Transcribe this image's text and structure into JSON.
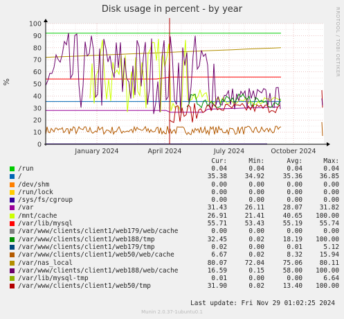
{
  "title": "Disk usage in percent - by year",
  "side_text": "RRDTOOL / TOBI OETIKER",
  "y_unit": "%",
  "footer": "Last update: Fri Nov 29 01:02:25 2024",
  "version": "Munin 2.0.37-1ubuntu0.1",
  "legend_header": {
    "cur": "Cur:",
    "min": "Min:",
    "avg": "Avg:",
    "max": "Max:"
  },
  "chart_data": {
    "type": "line",
    "ylim": [
      0,
      100
    ],
    "y_ticks": [
      "0",
      "10",
      "20",
      "30",
      "40",
      "50",
      "60",
      "70",
      "80",
      "90",
      "100"
    ],
    "x_tick_labels": [
      "January 2024",
      "April 2024",
      "July 2024",
      "October 2024"
    ],
    "grid": true,
    "series": [
      {
        "name": "/run",
        "color": "#00CC00",
        "cur": "0.04",
        "min": "0.04",
        "avg": "0.04",
        "max": "0.04"
      },
      {
        "name": "/",
        "color": "#0066B3",
        "cur": "35.38",
        "min": "34.92",
        "avg": "35.36",
        "max": "36.85"
      },
      {
        "name": "/dev/shm",
        "color": "#FF8000",
        "cur": "0.00",
        "min": "0.00",
        "avg": "0.00",
        "max": "0.00"
      },
      {
        "name": "/run/lock",
        "color": "#FFCC00",
        "cur": "0.00",
        "min": "0.00",
        "avg": "0.00",
        "max": "0.00"
      },
      {
        "name": "/sys/fs/cgroup",
        "color": "#330099",
        "cur": "0.00",
        "min": "0.00",
        "avg": "0.00",
        "max": "0.00"
      },
      {
        "name": "/var",
        "color": "#990099",
        "cur": "31.43",
        "min": "26.11",
        "avg": "28.07",
        "max": "31.82"
      },
      {
        "name": "/mnt/cache",
        "color": "#CCFF00",
        "cur": "26.91",
        "min": "21.41",
        "avg": "40.65",
        "max": "100.00"
      },
      {
        "name": "/var/lib/mysql",
        "color": "#FF0000",
        "cur": "55.71",
        "min": "53.43",
        "avg": "55.19",
        "max": "55.74"
      },
      {
        "name": "/var/www/clients/client1/web179/web/cache",
        "color": "#808080",
        "cur": "0.00",
        "min": "0.00",
        "avg": "0.00",
        "max": "0.00"
      },
      {
        "name": "/var/www/clients/client1/web188/tmp",
        "color": "#008F00",
        "cur": "32.45",
        "min": "0.02",
        "avg": "18.19",
        "max": "100.00"
      },
      {
        "name": "/var/www/clients/client1/web179/tmp",
        "color": "#00487D",
        "cur": "0.02",
        "min": "0.00",
        "avg": "0.01",
        "max": "5.12"
      },
      {
        "name": "/var/www/clients/client1/web50/web/cache",
        "color": "#B35A00",
        "cur": "6.67",
        "min": "0.02",
        "avg": "8.32",
        "max": "15.94"
      },
      {
        "name": "/var/nas_local",
        "color": "#B38F00",
        "cur": "80.07",
        "min": "72.04",
        "avg": "75.06",
        "max": "80.11"
      },
      {
        "name": "/var/www/clients/client1/web188/web/cache",
        "color": "#6B006B",
        "cur": "16.59",
        "min": "0.15",
        "avg": "58.00",
        "max": "100.00"
      },
      {
        "name": "/var/lib/mysql-tmp",
        "color": "#8FB300",
        "cur": "0.01",
        "min": "0.00",
        "avg": "0.00",
        "max": "6.64"
      },
      {
        "name": "/var/www/clients/client1/web50/tmp",
        "color": "#B30000",
        "cur": "31.90",
        "min": "0.02",
        "avg": "13.40",
        "max": "100.00"
      }
    ]
  }
}
